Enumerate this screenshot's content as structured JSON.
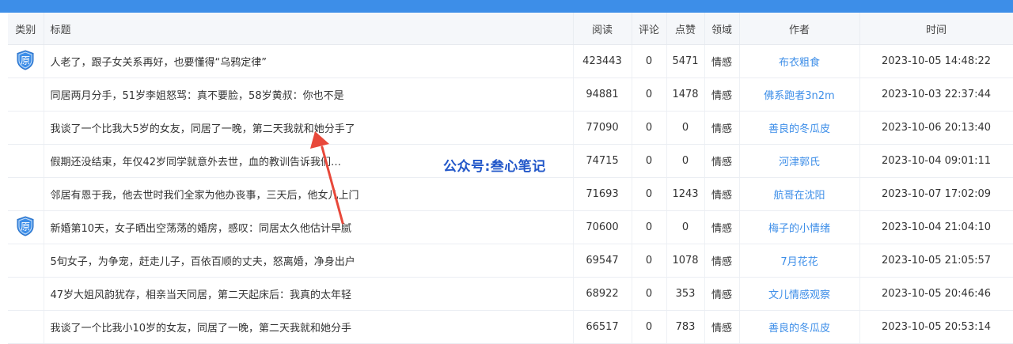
{
  "headers": {
    "category": "类别",
    "title": "标题",
    "reads": "阅读",
    "comments": "评论",
    "likes": "点赞",
    "domain": "领域",
    "author": "作者",
    "time": "时间"
  },
  "badge_text": "原",
  "watermark": "公众号:叁心笔记",
  "colors": {
    "accent": "#3d8ee8",
    "watermark": "#2257c9",
    "arrow": "#e8483a"
  },
  "rows": [
    {
      "original": true,
      "title": "人老了，跟子女关系再好，也要懂得“乌鸦定律”",
      "reads": "423443",
      "comments": "0",
      "likes": "5471",
      "domain": "情感",
      "author": "布衣粗食",
      "time": "2023-10-05 14:48:22"
    },
    {
      "original": false,
      "title": "同居两月分手，51岁李姐怒骂：真不要脸，58岁黄叔：你也不是",
      "reads": "94881",
      "comments": "0",
      "likes": "1478",
      "domain": "情感",
      "author": "佛系跑者3n2m",
      "time": "2023-10-03 22:37:44"
    },
    {
      "original": false,
      "title": "我谈了一个比我大5岁的女友，同居了一晚，第二天我就和她分手了",
      "reads": "77090",
      "comments": "0",
      "likes": "0",
      "domain": "情感",
      "author": "善良的冬瓜皮",
      "time": "2023-10-06 20:13:40"
    },
    {
      "original": false,
      "title": "假期还没结束，年仅42岁同学就意外去世，血的教训告诉我们…",
      "reads": "74715",
      "comments": "0",
      "likes": "0",
      "domain": "情感",
      "author": "河津郭氏",
      "time": "2023-10-04 09:01:11"
    },
    {
      "original": false,
      "title": "邻居有恩于我，他去世时我们全家为他办丧事，三天后，他女儿上门",
      "reads": "71693",
      "comments": "0",
      "likes": "1243",
      "domain": "情感",
      "author": "航哥在沈阳",
      "time": "2023-10-07 17:02:09"
    },
    {
      "original": true,
      "title": "新婚第10天，女子晒出空荡荡的婚房，感叹：同居太久他估计早腻",
      "reads": "70600",
      "comments": "0",
      "likes": "0",
      "domain": "情感",
      "author": "梅子的小情绪",
      "time": "2023-10-04 21:04:10"
    },
    {
      "original": false,
      "title": "5旬女子，为争宠，赶走儿子，百依百顺的丈夫，怒离婚，净身出户",
      "reads": "69547",
      "comments": "0",
      "likes": "1078",
      "domain": "情感",
      "author": "7月花花",
      "time": "2023-10-05 21:05:57"
    },
    {
      "original": false,
      "title": "47岁大姐风韵犹存，相亲当天同居，第二天起床后：我真的太年轻",
      "reads": "68922",
      "comments": "0",
      "likes": "353",
      "domain": "情感",
      "author": "文儿情感观察",
      "time": "2023-10-05 20:46:46"
    },
    {
      "original": false,
      "title": "我谈了一个比我小10岁的女友，同居了一晚，第二天我就和她分手",
      "reads": "66517",
      "comments": "0",
      "likes": "783",
      "domain": "情感",
      "author": "善良的冬瓜皮",
      "time": "2023-10-05 20:53:14"
    }
  ]
}
